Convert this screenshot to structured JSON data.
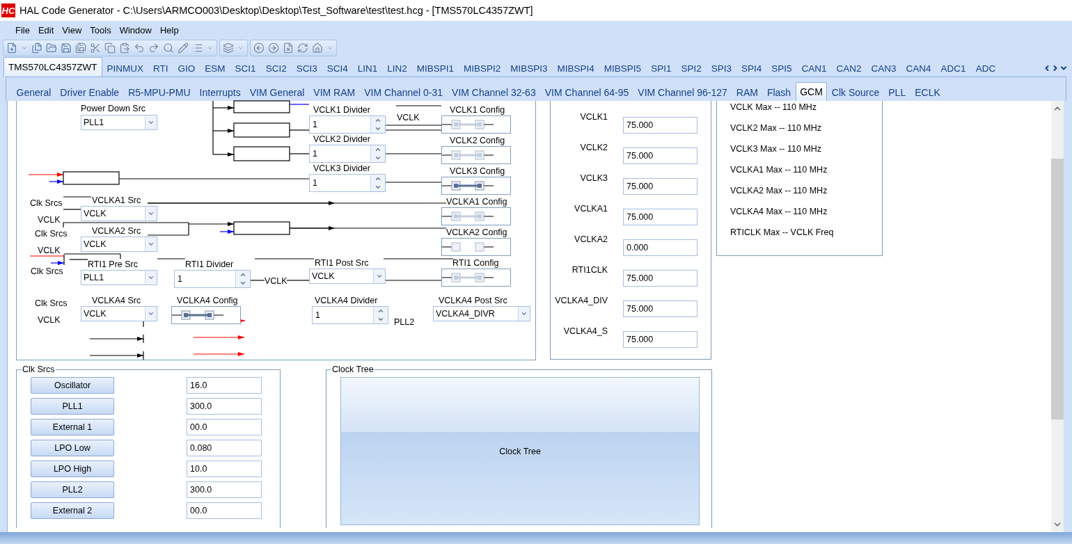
{
  "window": {
    "logo": "HC",
    "title": "HAL Code Generator - C:\\Users\\ARMCO003\\Desktop\\Desktop\\Test_Software\\test\\test.hcg - [TMS570LC4357ZWT]"
  },
  "menu": [
    "File",
    "Edit",
    "View",
    "Tools",
    "Window",
    "Help"
  ],
  "device_tabs": [
    {
      "label": "TMS570LC4357ZWT",
      "selected": true
    },
    {
      "label": "PINMUX",
      "selected": false
    },
    {
      "label": "RTI",
      "selected": false
    },
    {
      "label": "GIO",
      "selected": false
    },
    {
      "label": "ESM",
      "selected": false
    },
    {
      "label": "SCI1",
      "selected": false
    },
    {
      "label": "SCI2",
      "selected": false
    },
    {
      "label": "SCI3",
      "selected": false
    },
    {
      "label": "SCI4",
      "selected": false
    },
    {
      "label": "LIN1",
      "selected": false
    },
    {
      "label": "LIN2",
      "selected": false
    },
    {
      "label": "MIBSPI1",
      "selected": false
    },
    {
      "label": "MIBSPI2",
      "selected": false
    },
    {
      "label": "MIBSPI3",
      "selected": false
    },
    {
      "label": "MIBSPI4",
      "selected": false
    },
    {
      "label": "MIBSPI5",
      "selected": false
    },
    {
      "label": "SPI1",
      "selected": false
    },
    {
      "label": "SPI2",
      "selected": false
    },
    {
      "label": "SPI3",
      "selected": false
    },
    {
      "label": "SPI4",
      "selected": false
    },
    {
      "label": "SPI5",
      "selected": false
    },
    {
      "label": "CAN1",
      "selected": false
    },
    {
      "label": "CAN2",
      "selected": false
    },
    {
      "label": "CAN3",
      "selected": false
    },
    {
      "label": "CAN4",
      "selected": false
    },
    {
      "label": "ADC1",
      "selected": false
    },
    {
      "label": "ADC",
      "selected": false
    }
  ],
  "module_tabs": [
    {
      "label": "General",
      "selected": false
    },
    {
      "label": "Driver Enable",
      "selected": false
    },
    {
      "label": "R5-MPU-PMU",
      "selected": false
    },
    {
      "label": "Interrupts",
      "selected": false
    },
    {
      "label": "VIM General",
      "selected": false
    },
    {
      "label": "VIM RAM",
      "selected": false
    },
    {
      "label": "VIM Channel 0-31",
      "selected": false
    },
    {
      "label": "VIM Channel 32-63",
      "selected": false
    },
    {
      "label": "VIM Channel 64-95",
      "selected": false
    },
    {
      "label": "VIM Channel 96-127",
      "selected": false
    },
    {
      "label": "RAM",
      "selected": false
    },
    {
      "label": "Flash",
      "selected": false
    },
    {
      "label": "GCM",
      "selected": true
    },
    {
      "label": "Clk Source",
      "selected": false
    },
    {
      "label": "PLL",
      "selected": false
    },
    {
      "label": "ECLK",
      "selected": false
    }
  ],
  "diagram": {
    "items": [
      {
        "kind": "label",
        "text": "Power Down Src"
      },
      {
        "kind": "dropdown",
        "value": "PLL1"
      },
      {
        "kind": "label",
        "text": "VCLK1 Divider"
      },
      {
        "kind": "spinner",
        "value": "1"
      },
      {
        "kind": "label",
        "text": "VCLK"
      },
      {
        "kind": "label",
        "text": "VCLK1 Config"
      },
      {
        "kind": "config",
        "linked": true,
        "active": false
      },
      {
        "kind": "label",
        "text": "VCLK2 Divider"
      },
      {
        "kind": "spinner",
        "value": "1"
      },
      {
        "kind": "label",
        "text": "VCLK2 Config"
      },
      {
        "kind": "config",
        "linked": true,
        "active": false
      },
      {
        "kind": "label",
        "text": "VCLK3 Divider"
      },
      {
        "kind": "spinner",
        "value": "1"
      },
      {
        "kind": "label",
        "text": "VCLK3 Config"
      },
      {
        "kind": "config",
        "linked": true,
        "active": true
      },
      {
        "kind": "label",
        "text": "Clk Srcs"
      },
      {
        "kind": "label",
        "text": "VCLKA1 Src"
      },
      {
        "kind": "dropdown",
        "value": "VCLK"
      },
      {
        "kind": "label",
        "text": "VCLKA1 Config"
      },
      {
        "kind": "config",
        "linked": true,
        "active": false
      },
      {
        "kind": "label",
        "text": "VCLK"
      },
      {
        "kind": "label",
        "text": "Clk Srcs"
      },
      {
        "kind": "label",
        "text": "VCLKA2 Src"
      },
      {
        "kind": "dropdown",
        "value": "VCLK"
      },
      {
        "kind": "label",
        "text": "VCLKA2 Config"
      },
      {
        "kind": "config",
        "linked": false,
        "active": false
      },
      {
        "kind": "label",
        "text": "VCLK"
      },
      {
        "kind": "label",
        "text": "Clk Srcs"
      },
      {
        "kind": "label",
        "text": "RTI1 Pre Src"
      },
      {
        "kind": "dropdown",
        "value": "PLL1"
      },
      {
        "kind": "label",
        "text": "RTI1 Divider"
      },
      {
        "kind": "spinner",
        "value": "1"
      },
      {
        "kind": "label",
        "text": "VCLK"
      },
      {
        "kind": "label",
        "text": "RTI1 Post Src"
      },
      {
        "kind": "dropdown",
        "value": "VCLK"
      },
      {
        "kind": "label",
        "text": "RTI1 Config"
      },
      {
        "kind": "config",
        "linked": true,
        "active": false
      },
      {
        "kind": "label",
        "text": "Clk Srcs"
      },
      {
        "kind": "label",
        "text": "VCLKA4 Src"
      },
      {
        "kind": "dropdown",
        "value": "VCLK"
      },
      {
        "kind": "label",
        "text": "VCLKA4 Config"
      },
      {
        "kind": "config",
        "linked": true,
        "active": true
      },
      {
        "kind": "label",
        "text": "VCLKA4 Divider"
      },
      {
        "kind": "spinner",
        "value": "1"
      },
      {
        "kind": "label",
        "text": "VCLKA4 Post Src"
      },
      {
        "kind": "dropdown",
        "value": "VCLKA4_DIVR"
      },
      {
        "kind": "label",
        "text": "VCLK"
      },
      {
        "kind": "label",
        "text": "PLL2"
      }
    ]
  },
  "frequencies": [
    {
      "label": "VCLK1",
      "value": "75.000"
    },
    {
      "label": "VCLK2",
      "value": "75.000"
    },
    {
      "label": "VCLK3",
      "value": "75.000"
    },
    {
      "label": "VCLKA1",
      "value": "75.000"
    },
    {
      "label": "VCLKA2",
      "value": "0.000"
    },
    {
      "label": "RTI1CLK",
      "value": "75.000"
    },
    {
      "label": "VCLKA4_DIV",
      "value": "75.000"
    },
    {
      "label": "VCLKA4_S",
      "value": "75.000"
    }
  ],
  "limits": [
    "VCLK Max -- 110 MHz",
    "VCLK2 Max -- 110 MHz",
    "VCLK3 Max -- 110 MHz",
    "VCLKA1 Max -- 110 MHz",
    "VCLKA2 Max -- 110 MHz",
    "VCLKA4 Max -- 110 MHz",
    "RTICLK Max -- VCLK Freq"
  ],
  "clock_sources": {
    "title": "Clk Srcs",
    "items": [
      {
        "label": "Oscillator",
        "value": "16.0"
      },
      {
        "label": "PLL1",
        "value": "300.0"
      },
      {
        "label": "External 1",
        "value": "00.0"
      },
      {
        "label": "LPO Low",
        "value": "0.080"
      },
      {
        "label": "LPO High",
        "value": "10.0"
      },
      {
        "label": "PLL2",
        "value": "300.0"
      },
      {
        "label": "External 2",
        "value": "00.0"
      }
    ]
  },
  "clock_tree": {
    "title": "Clock Tree",
    "button": "Clock Tree"
  }
}
